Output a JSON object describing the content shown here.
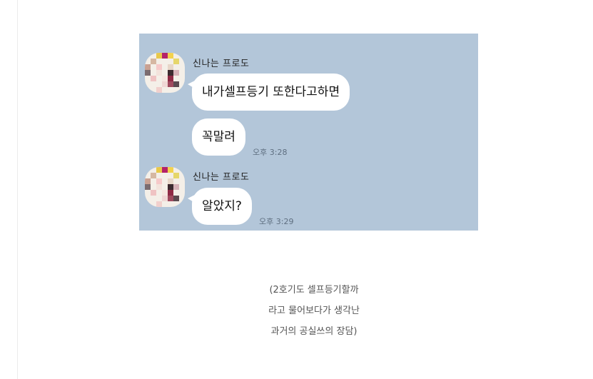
{
  "chat": {
    "messages": [
      {
        "sender": "신나는 프로도",
        "bubbles": [
          "내가셀프등기 또한다고하면",
          "꼭말려"
        ],
        "time": "오후 3:28"
      },
      {
        "sender": "신나는 프로도",
        "bubbles": [
          "알았지?"
        ],
        "time": "오후 3:29"
      }
    ],
    "background_color": "#b3c6d9",
    "bubble_color": "#ffffff"
  },
  "caption": {
    "lines": [
      "(2호기도 셀프등기할까",
      "라고 물어보다가 생각난",
      "과거의 공실쓰의 장담)"
    ]
  }
}
